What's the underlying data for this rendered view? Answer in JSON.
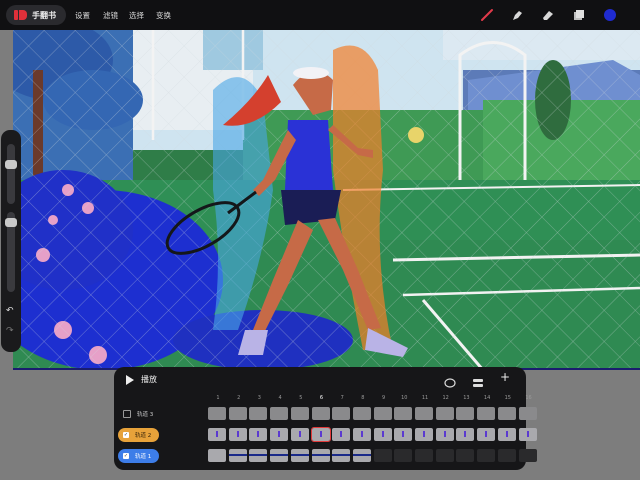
{
  "app": {
    "title": "手翻书"
  },
  "menu": {
    "settings": "设置",
    "filters": "滤镜",
    "select": "选择",
    "transform": "变换"
  },
  "tools": {
    "brush": "brush-icon",
    "smudge": "smudge-icon",
    "eraser": "eraser-icon",
    "layers": "layers-icon",
    "color": "#1f2bd0"
  },
  "timeline": {
    "play_label": "播放",
    "frame_numbers": [
      "1",
      "2",
      "3",
      "4",
      "5",
      "6",
      "7",
      "8",
      "9",
      "10",
      "11",
      "12",
      "13",
      "14",
      "15",
      "16"
    ],
    "current_frame": "6",
    "tracks": [
      {
        "label": "轨道 3",
        "checked": false
      },
      {
        "label": "轨道 2",
        "checked": true,
        "color": "#e7a23a"
      },
      {
        "label": "轨道 1",
        "checked": true,
        "color": "#3d7de8"
      }
    ]
  }
}
